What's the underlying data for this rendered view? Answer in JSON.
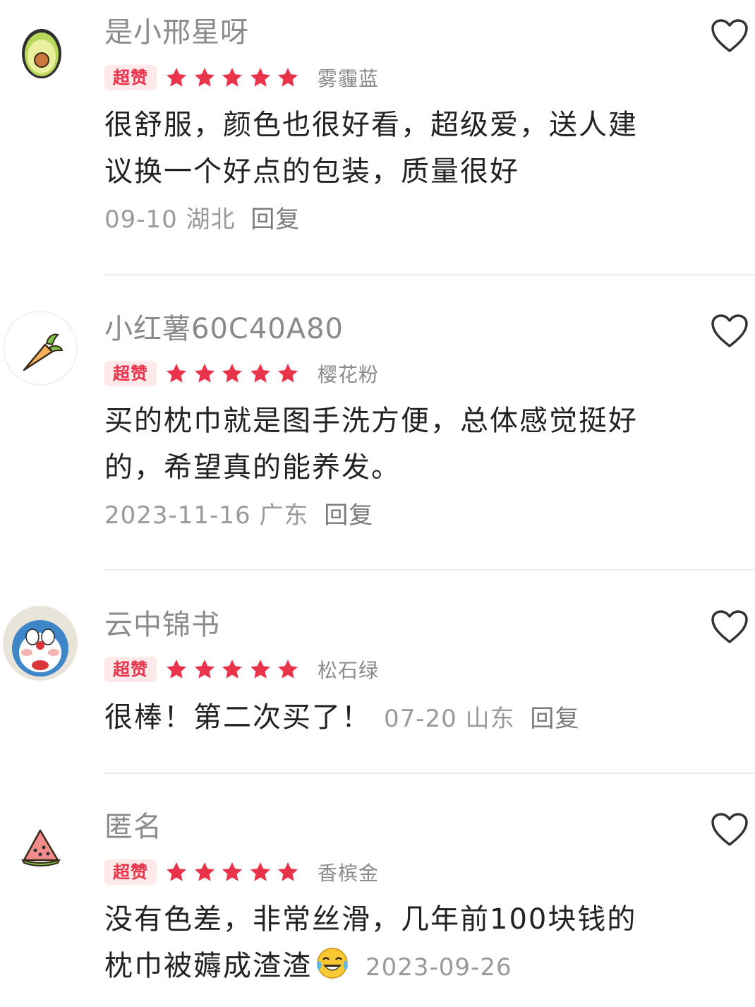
{
  "badge_label": "超赞",
  "reply_label": "回复",
  "rating_max": 5,
  "colors": {
    "accent": "#e8334a",
    "badge_bg": "#fde8ea",
    "text": "#222222",
    "muted": "#8a8a8a"
  },
  "reviews": [
    {
      "username": "是小邢星呀",
      "avatar_icon": "avocado-icon",
      "rating": 5,
      "variant": "雾霾蓝",
      "content_lines": [
        "很舒服，颜色也很好看，超级爱，送人建",
        "议换一个好点的包装，质量很好"
      ],
      "date": "09-10",
      "region": "湖北"
    },
    {
      "username": "小红薯60C40A80",
      "avatar_icon": "carrot-icon",
      "rating": 5,
      "variant": "樱花粉",
      "content_lines": [
        "买的枕巾就是图手洗方便，总体感觉挺好",
        "的，希望真的能养发。"
      ],
      "date": "2023-11-16",
      "region": "广东"
    },
    {
      "username": "云中锦书",
      "avatar_icon": "doraemon-avatar",
      "rating": 5,
      "variant": "松石绿",
      "content_lines": [
        "很棒！第二次买了！"
      ],
      "date": "07-20",
      "region": "山东"
    },
    {
      "username": "匿名",
      "avatar_icon": "watermelon-icon",
      "rating": 5,
      "variant": "香槟金",
      "content_lines": [
        "没有色差，非常丝滑，几年前100块钱的",
        "枕巾被薅成渣渣"
      ],
      "content_emoji": "laughing-tears-emoji",
      "date": "2023-09-26"
    }
  ]
}
